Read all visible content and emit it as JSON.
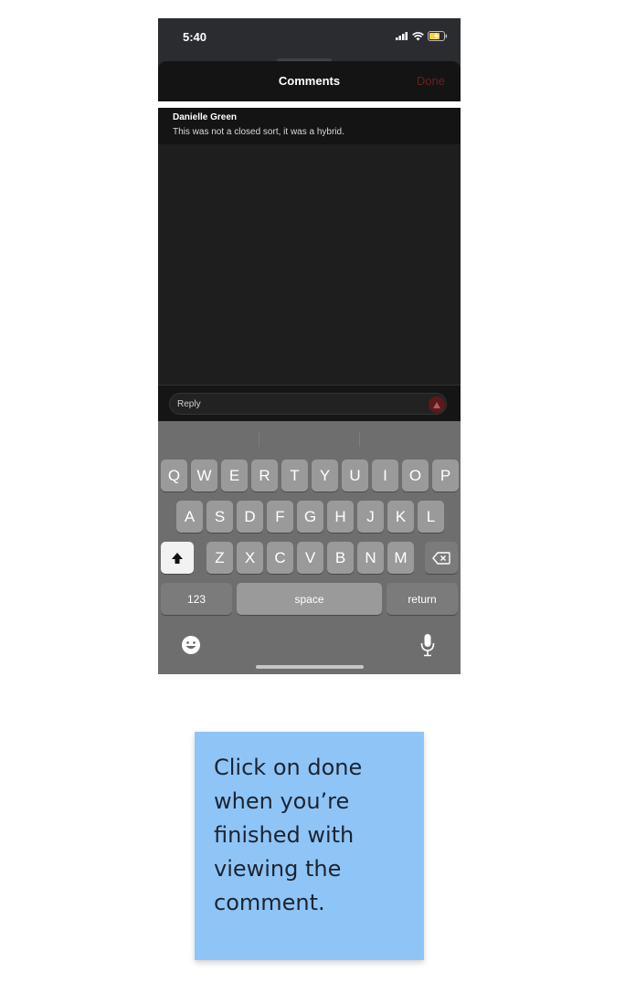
{
  "status_bar": {
    "time": "5:40"
  },
  "sheet": {
    "title": "Comments",
    "done_label": "Done"
  },
  "comments": [
    {
      "author": "Danielle Green",
      "text": "This was not a closed sort, it was a hybrid."
    }
  ],
  "reply": {
    "placeholder": "Reply"
  },
  "keyboard": {
    "row1": [
      "Q",
      "W",
      "E",
      "R",
      "T",
      "Y",
      "U",
      "I",
      "O",
      "P"
    ],
    "row2": [
      "A",
      "S",
      "D",
      "F",
      "G",
      "H",
      "J",
      "K",
      "L"
    ],
    "row3": [
      "Z",
      "X",
      "C",
      "V",
      "B",
      "N",
      "M"
    ],
    "numbers_label": "123",
    "space_label": "space",
    "return_label": "return"
  },
  "tooltip": {
    "text": "Click on done when you’re finished with viewing the comment."
  },
  "colors": {
    "accent_done": "#6b1f1f",
    "tooltip_bg": "#8fc5f6",
    "sheet_bg": "#141414"
  },
  "icons": [
    "signal-icon",
    "wifi-icon",
    "battery-icon",
    "send-icon",
    "shift-icon",
    "delete-icon",
    "emoji-icon",
    "microphone-icon"
  ]
}
